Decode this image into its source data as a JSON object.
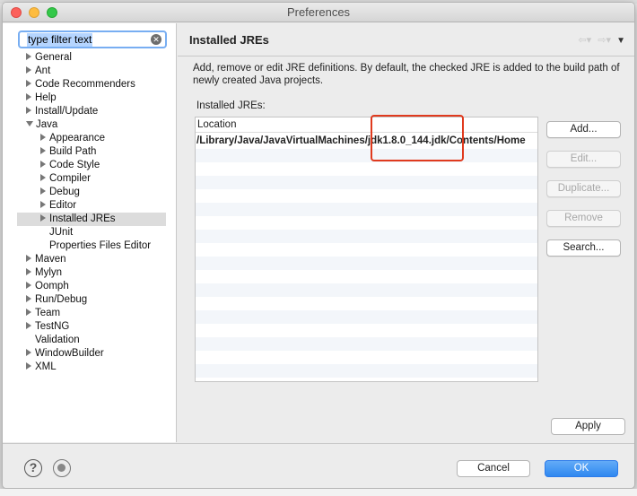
{
  "window": {
    "title": "Preferences"
  },
  "filter": {
    "value": "type filter text"
  },
  "tree": [
    {
      "label": "General",
      "expander": "right",
      "indent": 0
    },
    {
      "label": "Ant",
      "expander": "right",
      "indent": 0
    },
    {
      "label": "Code Recommenders",
      "expander": "right",
      "indent": 0
    },
    {
      "label": "Help",
      "expander": "right",
      "indent": 0
    },
    {
      "label": "Install/Update",
      "expander": "right",
      "indent": 0
    },
    {
      "label": "Java",
      "expander": "down",
      "indent": 0
    },
    {
      "label": "Appearance",
      "expander": "right",
      "indent": 1
    },
    {
      "label": "Build Path",
      "expander": "right",
      "indent": 1
    },
    {
      "label": "Code Style",
      "expander": "right",
      "indent": 1
    },
    {
      "label": "Compiler",
      "expander": "right",
      "indent": 1
    },
    {
      "label": "Debug",
      "expander": "right",
      "indent": 1
    },
    {
      "label": "Editor",
      "expander": "right",
      "indent": 1
    },
    {
      "label": "Installed JREs",
      "expander": "right",
      "indent": 1,
      "selected": true
    },
    {
      "label": "JUnit",
      "expander": "none",
      "indent": 1
    },
    {
      "label": "Properties Files Editor",
      "expander": "none",
      "indent": 1
    },
    {
      "label": "Maven",
      "expander": "right",
      "indent": 0
    },
    {
      "label": "Mylyn",
      "expander": "right",
      "indent": 0
    },
    {
      "label": "Oomph",
      "expander": "right",
      "indent": 0
    },
    {
      "label": "Run/Debug",
      "expander": "right",
      "indent": 0
    },
    {
      "label": "Team",
      "expander": "right",
      "indent": 0
    },
    {
      "label": "TestNG",
      "expander": "right",
      "indent": 0
    },
    {
      "label": "Validation",
      "expander": "none",
      "indent": 0
    },
    {
      "label": "WindowBuilder",
      "expander": "right",
      "indent": 0
    },
    {
      "label": "XML",
      "expander": "right",
      "indent": 0
    }
  ],
  "page": {
    "title": "Installed JREs",
    "description": "Add, remove or edit JRE definitions. By default, the checked JRE is added to the build path of newly created Java projects.",
    "list_label": "Installed JREs:",
    "table": {
      "column": "Location",
      "rows": [
        "/Library/Java/JavaVirtualMachines/jdk1.8.0_144.jdk/Contents/Home"
      ]
    }
  },
  "buttons": {
    "add": "Add...",
    "edit": "Edit...",
    "duplicate": "Duplicate...",
    "remove": "Remove",
    "search": "Search...",
    "apply": "Apply",
    "cancel": "Cancel",
    "ok": "OK"
  },
  "colors": {
    "highlight_box": "#e03a1e",
    "ok_button": "#2f88f0",
    "filter_focus": "#78aef2"
  }
}
